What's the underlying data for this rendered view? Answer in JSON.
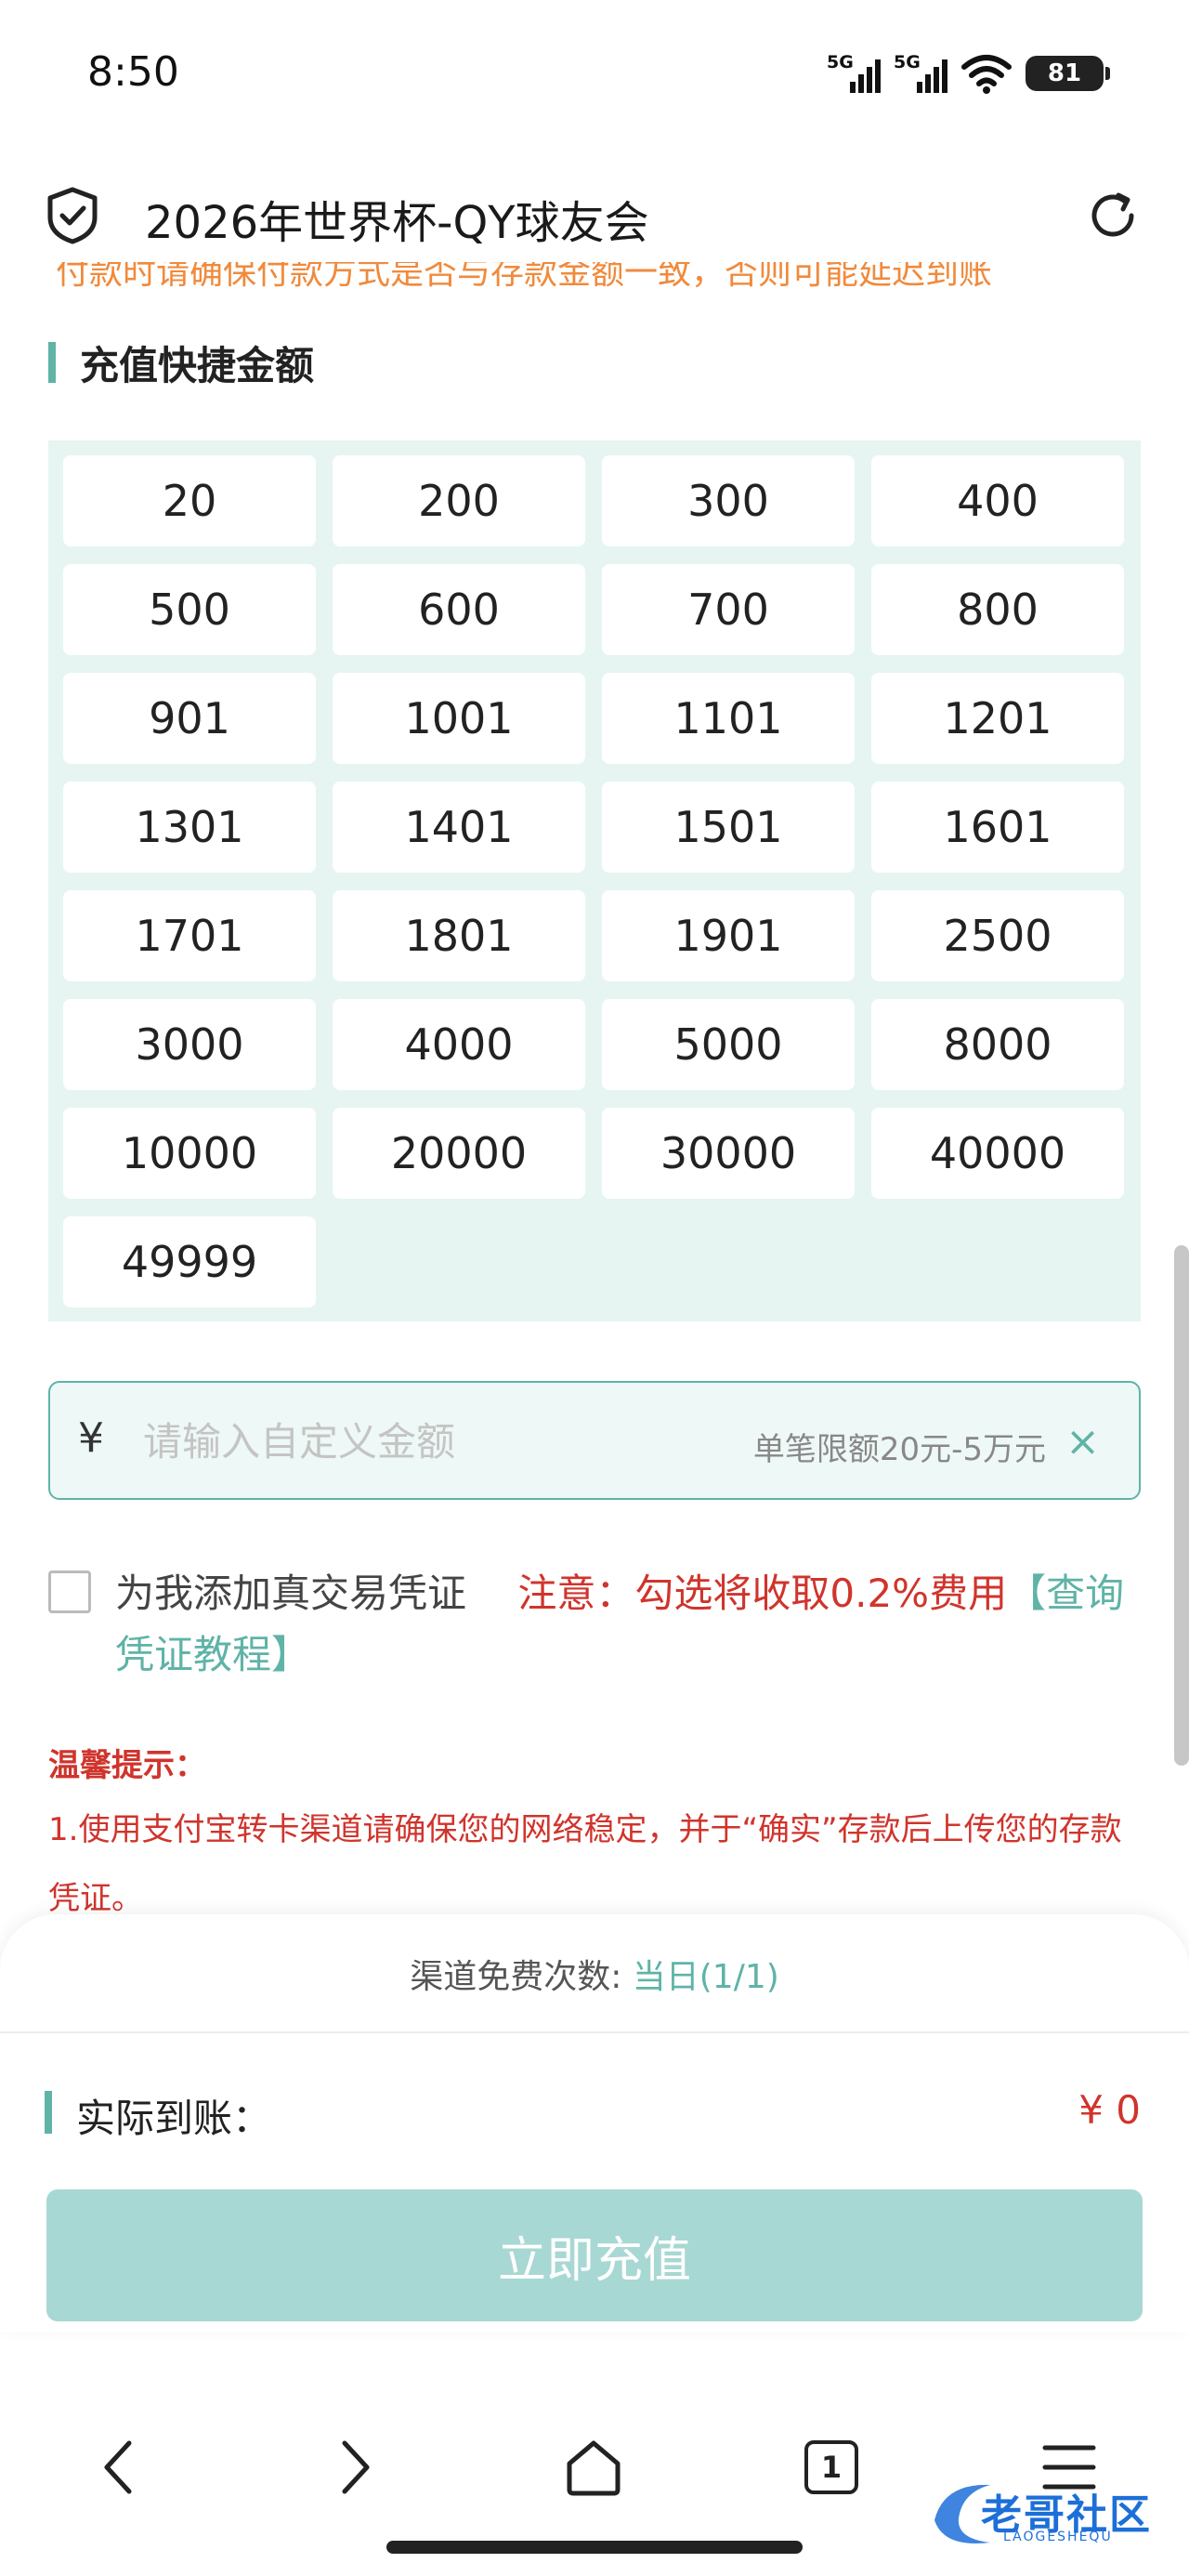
{
  "status_bar": {
    "time": "8:50",
    "signal1_label": "5G",
    "signal2_label": "5G",
    "battery": "81"
  },
  "header": {
    "title": "2026年世界杯-QY球友会"
  },
  "notice_clipped": "付款时请确保付款方式是否与存款金额一致，否则可能延迟到账",
  "quick_amounts": {
    "title": "充值快捷金额",
    "items": [
      "20",
      "200",
      "300",
      "400",
      "500",
      "600",
      "700",
      "800",
      "901",
      "1001",
      "1101",
      "1201",
      "1301",
      "1401",
      "1501",
      "1601",
      "1701",
      "1801",
      "1901",
      "2500",
      "3000",
      "4000",
      "5000",
      "8000",
      "10000",
      "20000",
      "30000",
      "40000",
      "49999"
    ]
  },
  "custom_amount": {
    "currency": "¥",
    "placeholder": "请输入自定义金额",
    "limit": "单笔限额20元-5万元",
    "clear": "×"
  },
  "voucher_option": {
    "label": "为我添加真交易凭证",
    "warning": "注意：勾选将收取0.2%费用",
    "link": "【查询凭证教程】"
  },
  "tips": {
    "title": "温馨提示：",
    "text": "1.使用支付宝转卡渠道请确保您的网络稳定，并于“确实”存款后上传您的存款凭证。"
  },
  "sheet": {
    "free_count_label": "渠道免费次数: ",
    "free_count_value": "当日(1/1)",
    "arrival_label": "实际到账：",
    "arrival_amount": "¥ 0",
    "submit": "立即充值"
  },
  "browser_nav": {
    "tab_count": "1"
  },
  "watermark": {
    "text": "老哥社区",
    "sub": "LAOGESHEQU"
  },
  "colors": {
    "accent": "#5fb3a7",
    "warning": "#d0342c",
    "grid_bg": "#e6f5f2",
    "button_disabled": "#a8d8d3"
  }
}
